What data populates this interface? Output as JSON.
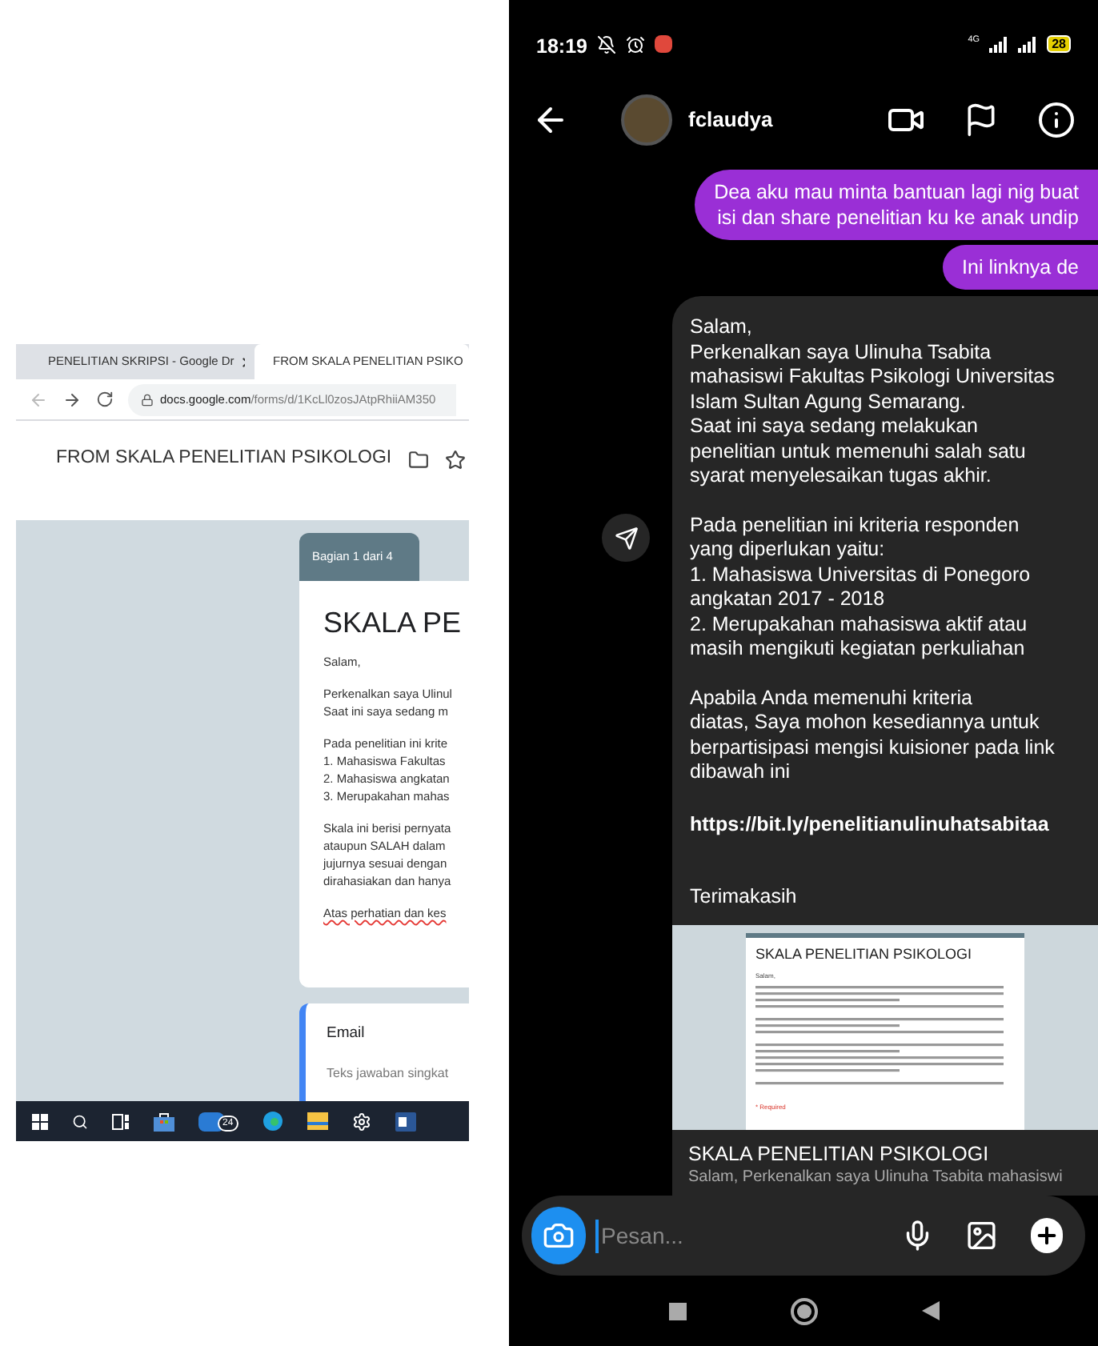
{
  "browser": {
    "tabs": [
      {
        "title": "PENELITIAN SKRIPSI - Google Dr",
        "selected": false
      },
      {
        "title": "FROM SKALA PENELITIAN PSIKO",
        "selected": true
      }
    ],
    "url_host": "docs.google.com",
    "url_path": "/forms/d/1KcLl0zosJAtpRhiiAM350",
    "doc_title": "FROM SKALA PENELITIAN PSIKOLOGI",
    "section_tab": "Bagian 1 dari 4",
    "form_title": "SKALA PE",
    "paragraphs": [
      "Salam,",
      "Perkenalkan saya Ulinul\nSaat ini saya sedang m",
      "Pada penelitian ini krite\n1. Mahasiswa Fakultas\n2. Mahasiswa angkatan\n3. Merupakahan mahas",
      "Skala ini berisi pernyata\nataupun SALAH dalam\njujurnya sesuai dengan\ndirahasiakan dan hanya"
    ],
    "closing": "Atas perhatian dan kes",
    "question": {
      "title": "Email",
      "placeholder": "Teks jawaban singkat"
    },
    "taskbar": {
      "mail_badge": "24"
    }
  },
  "phone": {
    "time": "18:19",
    "network": "4G",
    "battery": "28",
    "contact": "fclaudya",
    "sent": [
      {
        "text": "Dea aku mau minta bantuan lagi nig buat\nisi dan share penelitian ku ke anak undip"
      },
      {
        "text": "Ini linknya de"
      }
    ],
    "received": {
      "paragraphs": [
        "Salam,\nPerkenalkan saya Ulinuha Tsabita\nmahasiswi Fakultas Psikologi Universitas\nIslam Sultan Agung Semarang.\nSaat ini saya sedang melakukan\npenelitian untuk memenuhi salah satu\nsyarat menyelesaikan tugas akhir.",
        "Pada penelitian ini kriteria responden\nyang diperlukan yaitu:\n1. Mahasiswa Universitas di Ponegoro\nangkatan 2017 - 2018\n2. Merupakahan mahasiswa aktif atau\nmasih mengikuti kegiatan perkuliahan",
        "Apabila Anda memenuhi kriteria\ndiatas, Saya mohon kesediannya untuk\nberpartisipasi mengisi kuisioner pada link\ndibawah ini"
      ],
      "link": "https://bit.ly/penelitianulinuhatsabitaa",
      "thanks": "Terimakasih",
      "preview": {
        "image_title": "SKALA PENELITIAN PSIKOLOGI",
        "image_greeting": "Salam,",
        "image_required": "* Required",
        "title": "SKALA PENELITIAN PSIKOLOGI",
        "description": "Salam, Perkenalkan saya Ulinuha Tsabita mahasiswi"
      }
    },
    "composer": {
      "placeholder": "Pesan..."
    }
  }
}
